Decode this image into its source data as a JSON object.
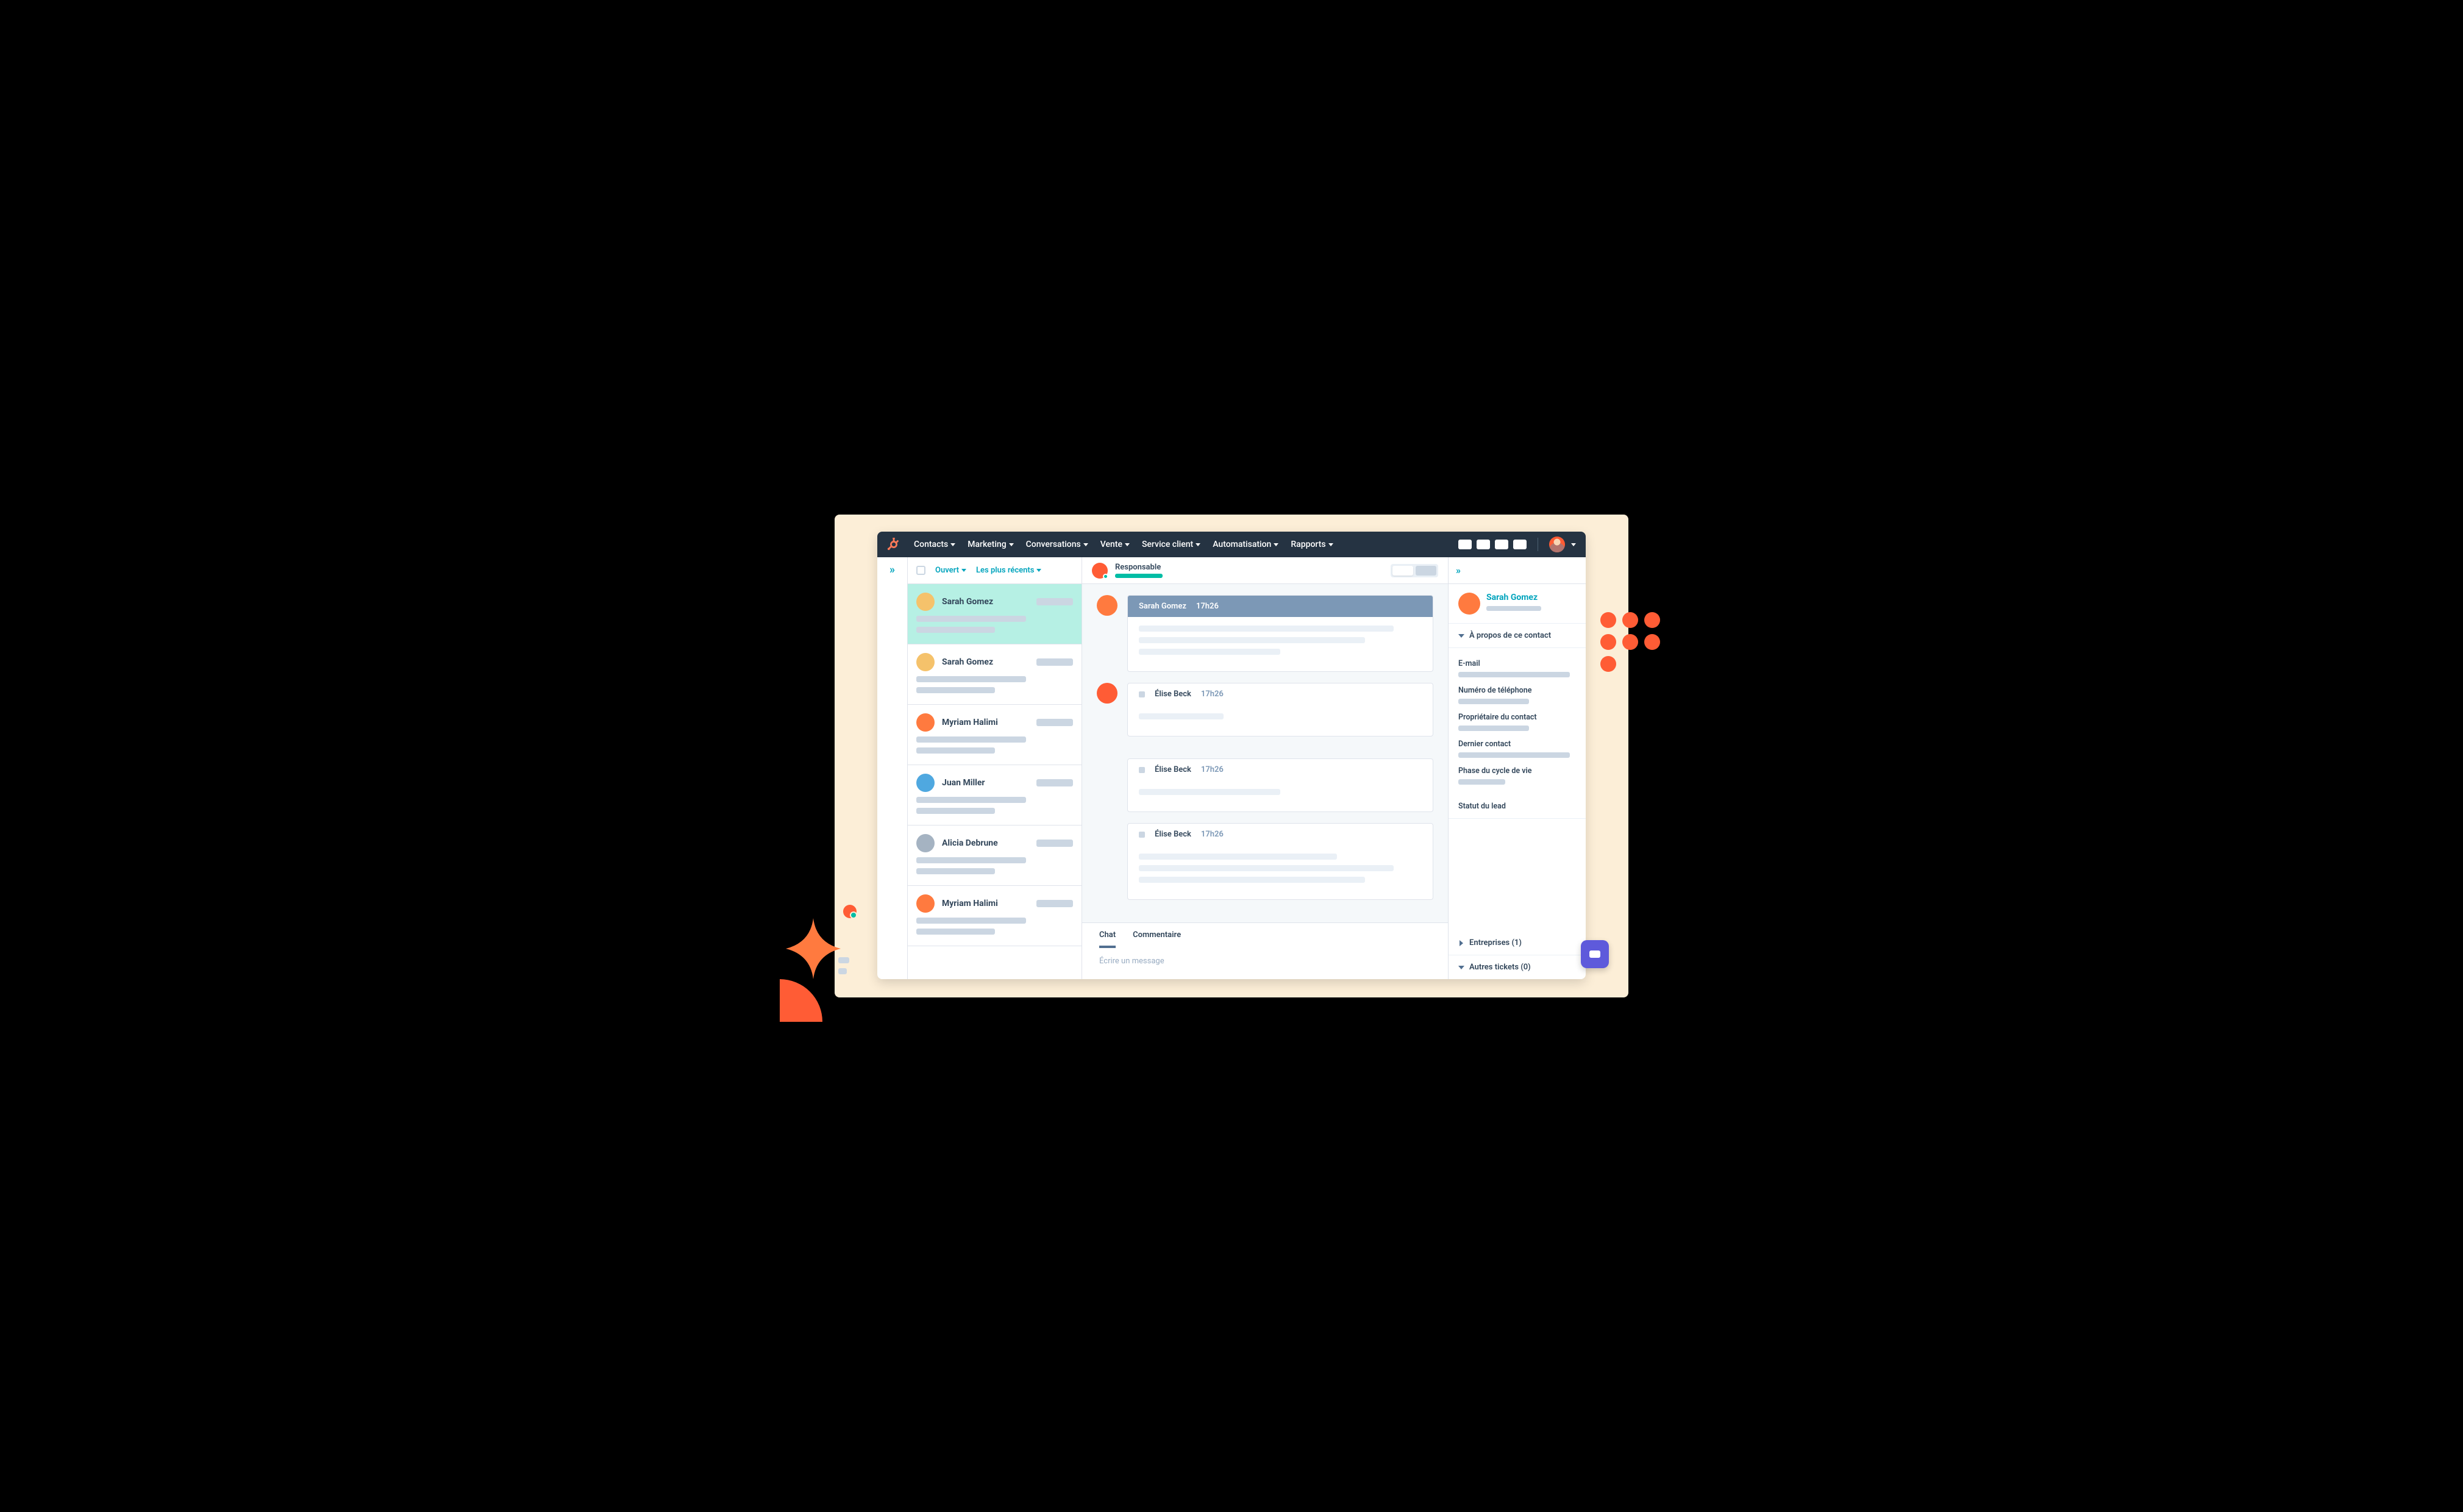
{
  "nav": {
    "items": [
      "Contacts",
      "Marketing",
      "Conversations",
      "Vente",
      "Service client",
      "Automatisation",
      "Rapports"
    ]
  },
  "filters": {
    "open": "Ouvert",
    "recent": "Les plus récents"
  },
  "conversations": [
    {
      "name": "Sarah Gomez",
      "selected": true
    },
    {
      "name": "Sarah Gomez",
      "selected": false
    },
    {
      "name": "Myriam Halimi",
      "selected": false
    },
    {
      "name": "Juan Miller",
      "selected": false
    },
    {
      "name": "Alicia Debrune",
      "selected": false
    },
    {
      "name": "Myriam Halimi",
      "selected": false
    }
  ],
  "thread": {
    "header_label": "Responsable",
    "messages": [
      {
        "sender": "Sarah Gomez",
        "time": "17h26",
        "dark": true
      },
      {
        "sender": "Élise Beck",
        "time": "17h26",
        "dark": false
      },
      {
        "sender": "Élise Beck",
        "time": "17h26",
        "dark": false
      },
      {
        "sender": "Élise Beck",
        "time": "17h26",
        "dark": false
      }
    ],
    "composer": {
      "tabs": [
        "Chat",
        "Commentaire"
      ],
      "placeholder": "Écrire un message"
    }
  },
  "contact": {
    "name": "Sarah Gomez",
    "about_section": "À propos de ce contact",
    "fields": {
      "email": "E-mail",
      "phone": "Numéro de téléphone",
      "owner": "Propriétaire du contact",
      "last": "Dernier contact",
      "lifecycle": "Phase du cycle de vie",
      "leadstatus": "Statut du lead"
    },
    "companies": "Entreprises (1)",
    "other_tickets": "Autres tickets (0)"
  }
}
